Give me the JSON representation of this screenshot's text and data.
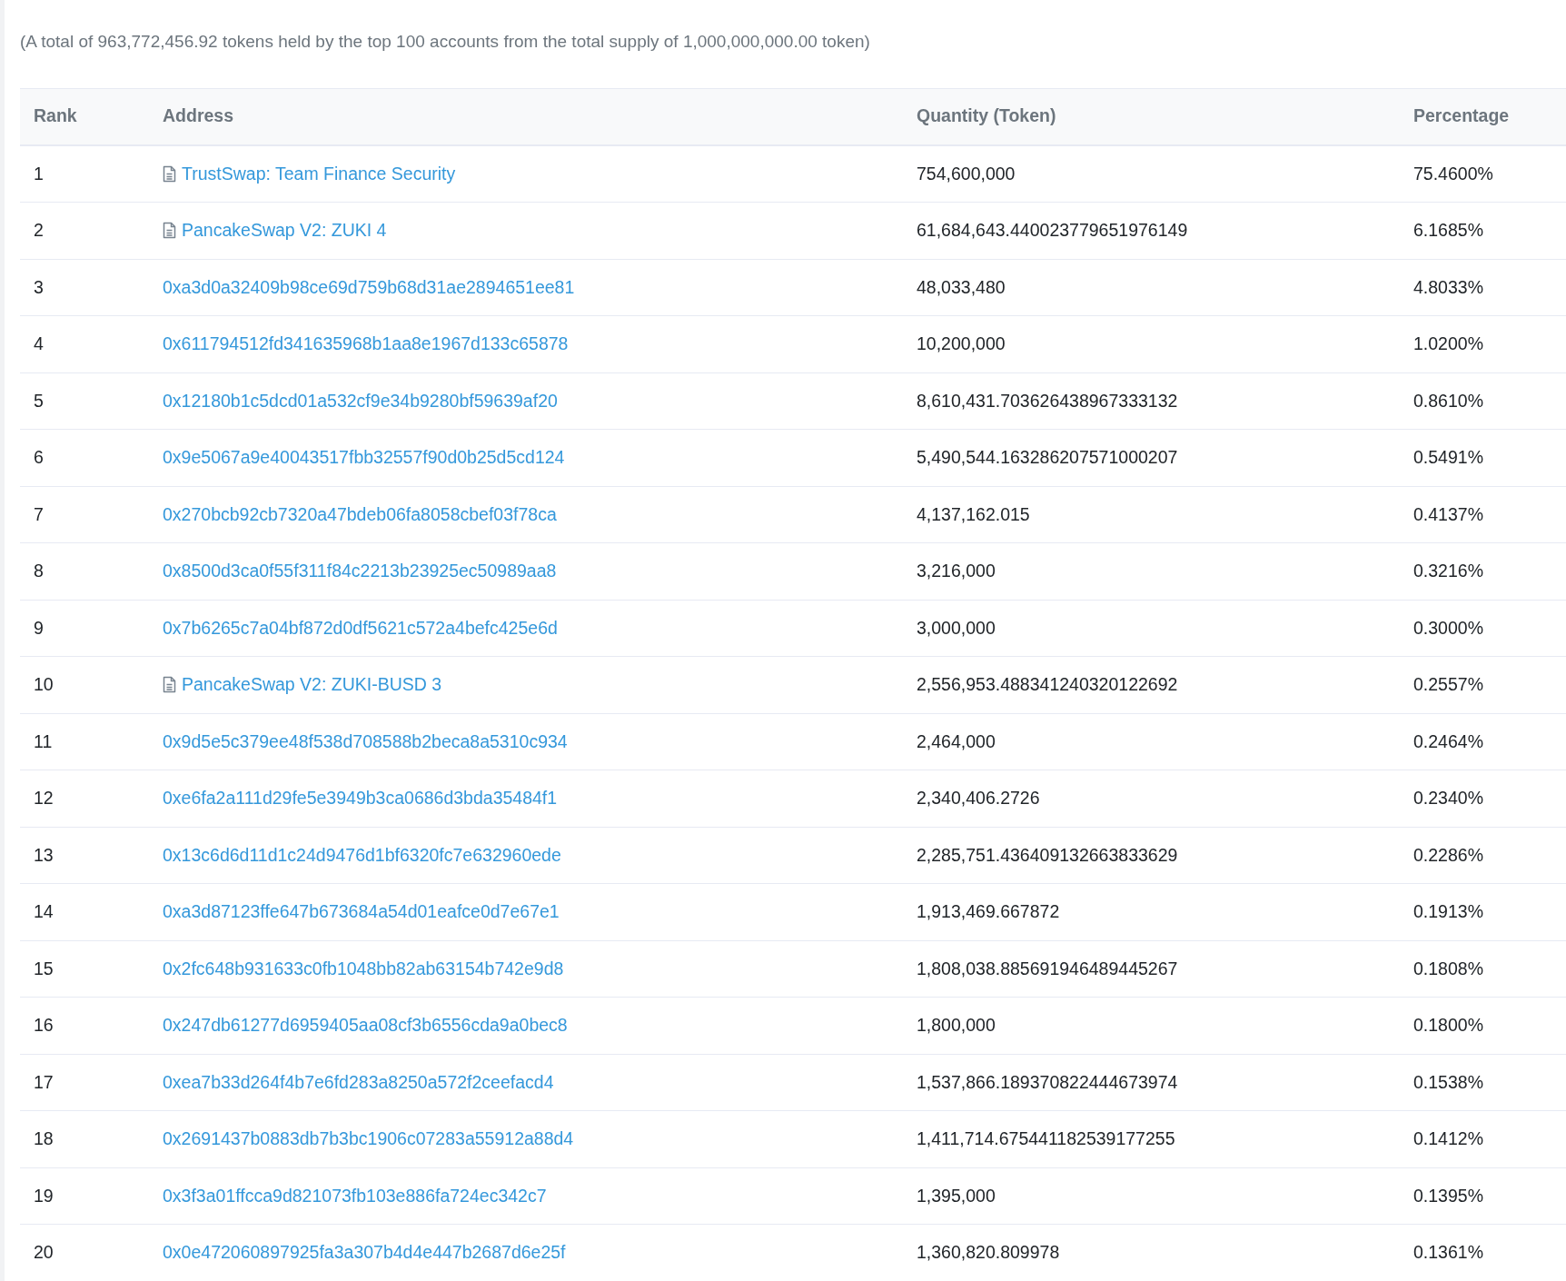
{
  "summary": "(A total of 963,772,456.92 tokens held by the top 100 accounts from the total supply of 1,000,000,000.00 token)",
  "table": {
    "columns": [
      "Rank",
      "Address",
      "Quantity (Token)",
      "Percentage"
    ],
    "rows": [
      {
        "rank": "1",
        "kind": "contract",
        "address": "TrustSwap: Team Finance Security",
        "quantity": "754,600,000",
        "percentage": "75.4600%"
      },
      {
        "rank": "2",
        "kind": "contract",
        "address": "PancakeSwap V2: ZUKI 4",
        "quantity": "61,684,643.440023779651976149",
        "percentage": "6.1685%"
      },
      {
        "rank": "3",
        "kind": "wallet",
        "address": "0xa3d0a32409b98ce69d759b68d31ae2894651ee81",
        "quantity": "48,033,480",
        "percentage": "4.8033%"
      },
      {
        "rank": "4",
        "kind": "wallet",
        "address": "0x611794512fd341635968b1aa8e1967d133c65878",
        "quantity": "10,200,000",
        "percentage": "1.0200%"
      },
      {
        "rank": "5",
        "kind": "wallet",
        "address": "0x12180b1c5dcd01a532cf9e34b9280bf59639af20",
        "quantity": "8,610,431.703626438967333132",
        "percentage": "0.8610%"
      },
      {
        "rank": "6",
        "kind": "wallet",
        "address": "0x9e5067a9e40043517fbb32557f90d0b25d5cd124",
        "quantity": "5,490,544.163286207571000207",
        "percentage": "0.5491%"
      },
      {
        "rank": "7",
        "kind": "wallet",
        "address": "0x270bcb92cb7320a47bdeb06fa8058cbef03f78ca",
        "quantity": "4,137,162.015",
        "percentage": "0.4137%"
      },
      {
        "rank": "8",
        "kind": "wallet",
        "address": "0x8500d3ca0f55f311f84c2213b23925ec50989aa8",
        "quantity": "3,216,000",
        "percentage": "0.3216%"
      },
      {
        "rank": "9",
        "kind": "wallet",
        "address": "0x7b6265c7a04bf872d0df5621c572a4befc425e6d",
        "quantity": "3,000,000",
        "percentage": "0.3000%"
      },
      {
        "rank": "10",
        "kind": "contract",
        "address": "PancakeSwap V2: ZUKI-BUSD 3",
        "quantity": "2,556,953.488341240320122692",
        "percentage": "0.2557%"
      },
      {
        "rank": "11",
        "kind": "wallet",
        "address": "0x9d5e5c379ee48f538d708588b2beca8a5310c934",
        "quantity": "2,464,000",
        "percentage": "0.2464%"
      },
      {
        "rank": "12",
        "kind": "wallet",
        "address": "0xe6fa2a111d29fe5e3949b3ca0686d3bda35484f1",
        "quantity": "2,340,406.2726",
        "percentage": "0.2340%"
      },
      {
        "rank": "13",
        "kind": "wallet",
        "address": "0x13c6d6d11d1c24d9476d1bf6320fc7e632960ede",
        "quantity": "2,285,751.436409132663833629",
        "percentage": "0.2286%"
      },
      {
        "rank": "14",
        "kind": "wallet",
        "address": "0xa3d87123ffe647b673684a54d01eafce0d7e67e1",
        "quantity": "1,913,469.667872",
        "percentage": "0.1913%"
      },
      {
        "rank": "15",
        "kind": "wallet",
        "address": "0x2fc648b931633c0fb1048bb82ab63154b742e9d8",
        "quantity": "1,808,038.885691946489445267",
        "percentage": "0.1808%"
      },
      {
        "rank": "16",
        "kind": "wallet",
        "address": "0x247db61277d6959405aa08cf3b6556cda9a0bec8",
        "quantity": "1,800,000",
        "percentage": "0.1800%"
      },
      {
        "rank": "17",
        "kind": "wallet",
        "address": "0xea7b33d264f4b7e6fd283a8250a572f2ceefacd4",
        "quantity": "1,537,866.189370822444673974",
        "percentage": "0.1538%"
      },
      {
        "rank": "18",
        "kind": "wallet",
        "address": "0x2691437b0883db7b3bc1906c07283a55912a88d4",
        "quantity": "1,411,714.675441182539177255",
        "percentage": "0.1412%"
      },
      {
        "rank": "19",
        "kind": "wallet",
        "address": "0x3f3a01ffcca9d821073fb103e886fa724ec342c7",
        "quantity": "1,395,000",
        "percentage": "0.1395%"
      },
      {
        "rank": "20",
        "kind": "wallet",
        "address": "0x0e472060897925fa3a307b4d4e447b2687d6e25f",
        "quantity": "1,360,820.809978",
        "percentage": "0.1361%"
      }
    ]
  }
}
